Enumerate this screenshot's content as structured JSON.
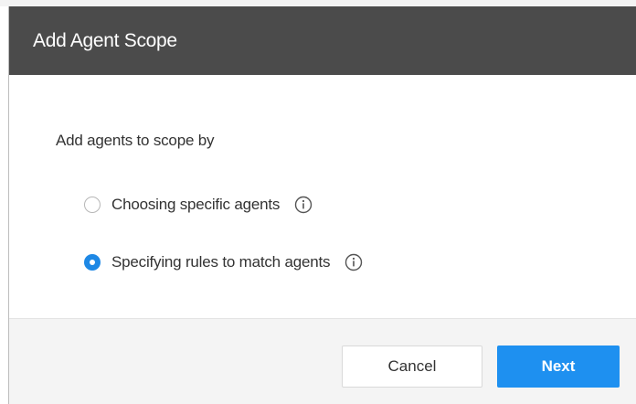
{
  "dialog": {
    "title": "Add Agent Scope",
    "prompt": "Add agents to scope by",
    "options": [
      {
        "label": "Choosing specific agents",
        "selected": false,
        "info_icon": "info-icon"
      },
      {
        "label": "Specifying rules to match agents",
        "selected": true,
        "info_icon": "info-icon"
      }
    ],
    "buttons": {
      "cancel_label": "Cancel",
      "next_label": "Next"
    }
  },
  "colors": {
    "header_bg": "#4b4b4b",
    "accent": "#1e88e5",
    "primary_button": "#1e90f0",
    "footer_bg": "#f4f4f4"
  }
}
